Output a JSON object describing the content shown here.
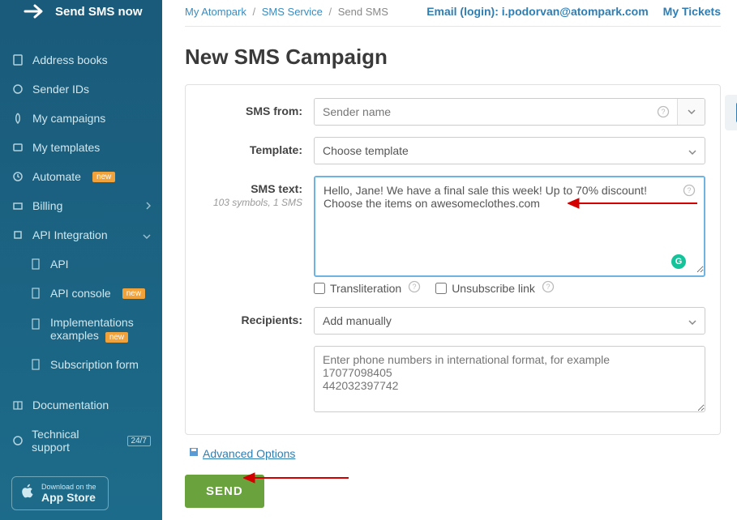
{
  "sidebar": {
    "send_now": "Send SMS now",
    "items": [
      {
        "icon": "book",
        "label": "Address books"
      },
      {
        "icon": "id",
        "label": "Sender IDs"
      },
      {
        "icon": "campaign",
        "label": "My campaigns"
      },
      {
        "icon": "template",
        "label": "My templates"
      },
      {
        "icon": "automate",
        "label": "Automate",
        "badge": "new"
      },
      {
        "icon": "billing",
        "label": "Billing",
        "caret": true
      },
      {
        "icon": "api",
        "label": "API Integration",
        "caret_down": true
      }
    ],
    "api_sub": [
      {
        "label": "API"
      },
      {
        "label": "API console",
        "badge": "new"
      },
      {
        "label": "Implementations examples",
        "badge": "new"
      },
      {
        "label": "Subscription form"
      }
    ],
    "bottom": [
      {
        "icon": "doc",
        "label": "Documentation"
      },
      {
        "icon": "support",
        "label": "Technical support",
        "badge247": "24/7"
      }
    ],
    "appstore": {
      "small": "Download on the",
      "big": "App Store"
    }
  },
  "breadcrumb": {
    "a": "My Atompark",
    "b": "SMS Service",
    "c": "Send SMS"
  },
  "top": {
    "email_label": "Email (login): ",
    "email_value": "i.podorvan@atompark.com",
    "tickets": "My Tickets"
  },
  "page_title": "New SMS Campaign",
  "form": {
    "sms_from_label": "SMS from:",
    "sms_from_placeholder": "Sender name",
    "template_label": "Template:",
    "template_value": "Choose template",
    "sms_text_label": "SMS text:",
    "sms_text_sub": "103 symbols, 1 SMS",
    "sms_text_value": "Hello, Jane! We have a final sale this week! Up to 70% discount! Choose the items on awesomeclothes.com",
    "transliteration": "Transliteration",
    "unsubscribe": "Unsubscribe link",
    "recipients_label": "Recipients:",
    "recipients_value": "Add manually",
    "phones_placeholder": "Enter phone numbers in international format, for example\n17077098405\n442032397742",
    "advanced": "Advanced Options",
    "send": "SEND"
  }
}
